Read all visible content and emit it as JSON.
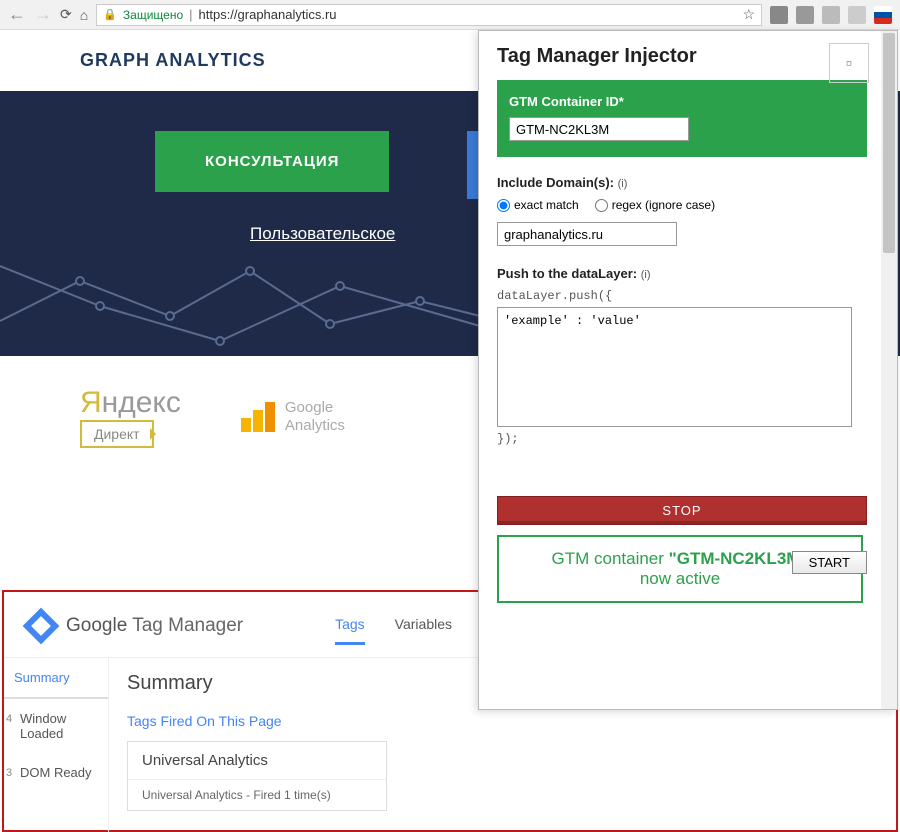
{
  "browser": {
    "secure_label": "Защищено",
    "url": "https://graphanalytics.ru"
  },
  "page": {
    "logo": "GRAPH ANALYTICS",
    "consult_btn": "КОНСУЛЬТАЦИЯ",
    "hero_link": "Пользовательское",
    "yandex_ya": "Я",
    "yandex_rest": "ндекс",
    "yandex_badge": "Директ",
    "ga_top": "Google",
    "ga_bottom": "Analytics"
  },
  "gtm": {
    "brand_bold": "Google",
    "brand_rest": " Tag Manager",
    "tabs": {
      "tags": "Tags",
      "variables": "Variables"
    },
    "side": {
      "summary": "Summary",
      "window_loaded": "Window Loaded",
      "window_loaded_num": "4",
      "dom_ready": "DOM Ready",
      "dom_ready_num": "3"
    },
    "main": {
      "heading": "Summary",
      "fired": "Tags Fired On This Page",
      "card_title": "Universal Analytics",
      "card_body": "Universal Analytics - Fired 1 time(s)"
    }
  },
  "popup": {
    "title": "Tag Manager Injector",
    "container_label": "GTM Container ID*",
    "container_value": "GTM-NC2KL3M",
    "include_label_bold": "Include Domain(s):",
    "info": "(i)",
    "radio_exact": "exact match",
    "radio_regex": "regex (ignore case)",
    "domain_value": "graphanalytics.ru",
    "push_label_bold": "Push to the dataLayer:",
    "push_pre": "dataLayer.push({",
    "push_body": "'example' : 'value'",
    "push_post": "});",
    "start": "START",
    "stop": "STOP",
    "active_prefix": "GTM container ",
    "active_id": "\"GTM-NC2KL3M\"",
    "active_suffix": " now active"
  }
}
